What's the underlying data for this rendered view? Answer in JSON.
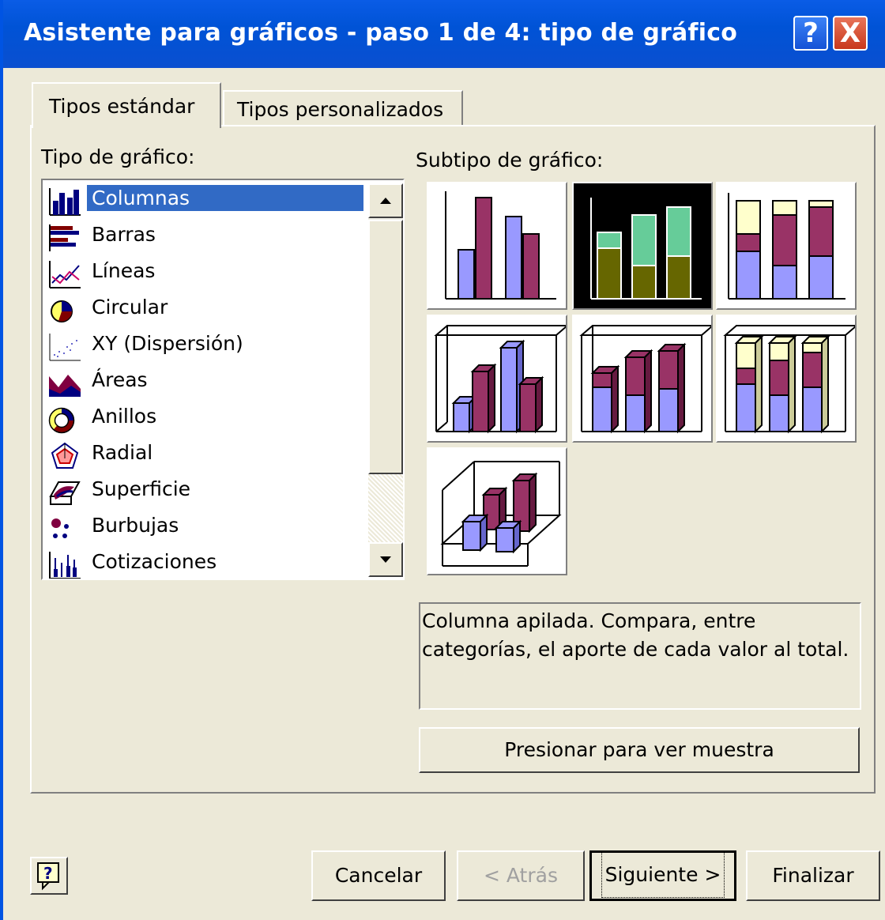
{
  "window": {
    "title": "Asistente para gráficos - paso 1 de 4: tipo de gráfico",
    "help_button": "?",
    "close_button": "X"
  },
  "tabs": [
    {
      "label": "Tipos estándar",
      "selected": true
    },
    {
      "label": "Tipos personalizados",
      "selected": false
    }
  ],
  "chart_type": {
    "label": "Tipo de gráfico:",
    "items": [
      {
        "label": "Columnas",
        "icon": "column-chart-icon",
        "selected": true
      },
      {
        "label": "Barras",
        "icon": "bar-chart-icon"
      },
      {
        "label": "Líneas",
        "icon": "line-chart-icon"
      },
      {
        "label": "Circular",
        "icon": "pie-chart-icon"
      },
      {
        "label": "XY (Dispersión)",
        "icon": "scatter-chart-icon"
      },
      {
        "label": "Áreas",
        "icon": "area-chart-icon"
      },
      {
        "label": "Anillos",
        "icon": "doughnut-chart-icon"
      },
      {
        "label": "Radial",
        "icon": "radar-chart-icon"
      },
      {
        "label": "Superficie",
        "icon": "surface-chart-icon"
      },
      {
        "label": "Burbujas",
        "icon": "bubble-chart-icon"
      },
      {
        "label": "Cotizaciones",
        "icon": "stock-chart-icon"
      }
    ]
  },
  "subtype": {
    "label": "Subtipo de gráfico:",
    "selected_index": 1,
    "description": "Columna apilada. Compara, entre categorías, el aporte de cada valor al total."
  },
  "buttons": {
    "sample": "Presionar para ver muestra",
    "cancel": "Cancelar",
    "back": "< Atrás",
    "next": "Siguiente >",
    "finish": "Finalizar"
  },
  "colors": {
    "title_bar": "#0053d6",
    "selection": "#316ac5",
    "series_lavender": "#9999ff",
    "series_plum": "#993366",
    "series_cream": "#ffffcc",
    "series_olive": "#666600",
    "series_mint": "#66cc99"
  }
}
